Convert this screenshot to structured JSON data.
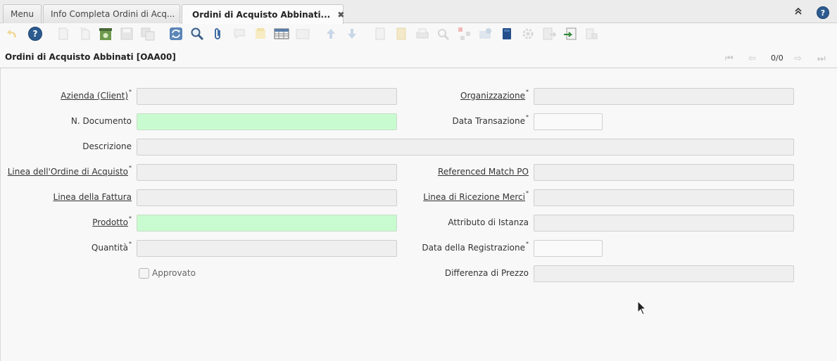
{
  "tabs": [
    {
      "label": "Menu"
    },
    {
      "label": "Info Completa Ordini di Acq..."
    },
    {
      "label": "Ordini di Acquisto Abbinati..."
    }
  ],
  "window": {
    "title": "Ordini di Acquisto Abbinati [OAA00]",
    "record_counter": "0/0"
  },
  "form": {
    "azienda": {
      "label": "Azienda (Client)",
      "value": ""
    },
    "organizzazione": {
      "label": "Organizzazione",
      "value": ""
    },
    "n_documento": {
      "label": "N. Documento",
      "value": ""
    },
    "data_transazione": {
      "label": "Data Transazione",
      "value": ""
    },
    "descrizione": {
      "label": "Descrizione",
      "value": ""
    },
    "linea_ordine": {
      "label": "Linea dell'Ordine di Acquisto",
      "value": ""
    },
    "referenced_match": {
      "label": "Referenced Match PO",
      "value": ""
    },
    "linea_fattura": {
      "label": "Linea della Fattura",
      "value": ""
    },
    "linea_ricezione": {
      "label": "Linea di Ricezione Merci",
      "value": ""
    },
    "prodotto": {
      "label": "Prodotto",
      "value": ""
    },
    "attributo_istanza": {
      "label": "Attributo di Istanza",
      "value": ""
    },
    "quantita": {
      "label": "Quantità",
      "value": ""
    },
    "data_registrazione": {
      "label": "Data della Registrazione",
      "value": ""
    },
    "approvato": {
      "label": "Approvato",
      "checked": false
    },
    "differenza_prezzo": {
      "label": "Differenza di Prezzo",
      "value": ""
    }
  },
  "colors": {
    "mandatory_field": "#c8fcd0",
    "readonly_field": "#efefef",
    "accent": "#2c5b8f"
  },
  "icons": [
    "undo-icon",
    "help-icon",
    "new-record-icon",
    "copy-icon",
    "delete-icon",
    "save-icon",
    "save-create-icon",
    "refresh-icon",
    "find-icon",
    "attachment-icon",
    "chat-icon",
    "postit-icon",
    "grid-toggle-icon",
    "zoom-across-icon",
    "parent-record-icon",
    "detail-record-icon",
    "report-icon",
    "archive-icon",
    "print-icon",
    "lookup-icon",
    "workflow-icon",
    "product-info-icon",
    "customize-icon",
    "process-icon",
    "export-icon",
    "import-icon",
    "quick-form-icon"
  ]
}
